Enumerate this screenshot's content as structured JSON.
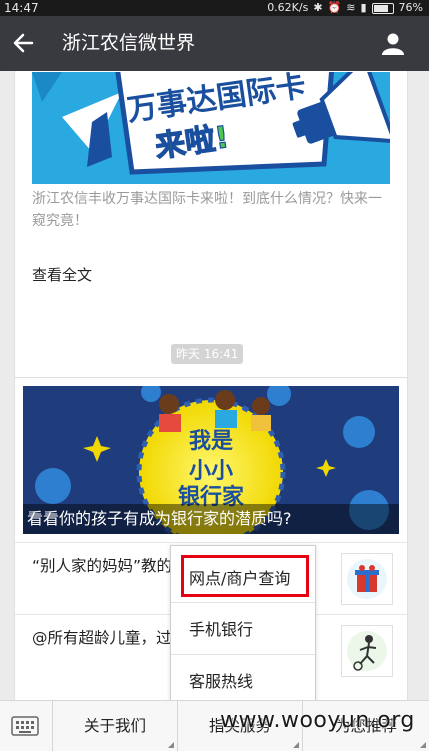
{
  "status_bar": {
    "time": "14:47",
    "network_speed": "0.62K/s",
    "battery": "76%",
    "battery_level": 0.76
  },
  "nav": {
    "title": "浙江农信微世界"
  },
  "article_card": {
    "banner_text_line1": "万事达国际卡",
    "banner_text_line2": "来啦!",
    "description": "浙江农信丰收万事达国际卡来啦！到底什么情况？快来一窥究竟！",
    "read_more_label": "查看全文"
  },
  "timestamp": "昨天 16:41",
  "news_card": {
    "banner_badge_lines": [
      "我是",
      "小小",
      "银行家"
    ],
    "banner_caption": "看看你的孩子有成为银行家的潜质吗?",
    "articles": [
      {
        "title": "“别人家的妈妈”教的六一节礼物"
      },
      {
        "title": "@所有超龄儿童，过这些，你就暴露"
      }
    ]
  },
  "popup_menu": {
    "items": [
      {
        "label": "网点/商户查询",
        "highlighted": true
      },
      {
        "label": "手机银行"
      },
      {
        "label": "客服热线"
      }
    ],
    "highlight_color": "#e60012"
  },
  "bottom_menu": {
    "tabs": [
      {
        "label": "关于我们"
      },
      {
        "label": "指尖服务"
      },
      {
        "label": "为您推荐"
      }
    ]
  },
  "watermark": "www.wooyun.org",
  "colors": {
    "nav_bg": "#393a3f",
    "page_bg": "#ebebeb",
    "highlight": "#e60012"
  }
}
